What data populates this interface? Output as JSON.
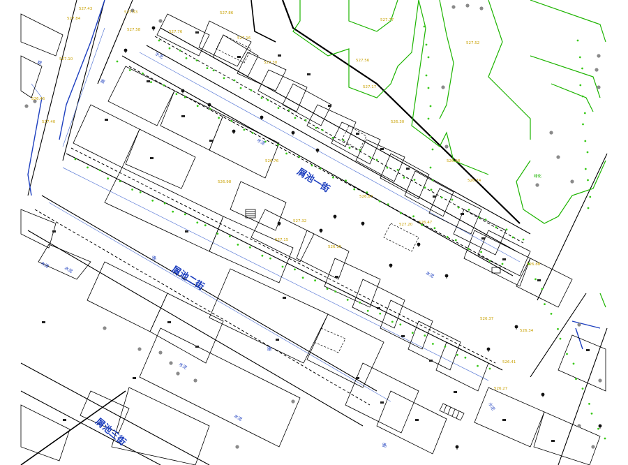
{
  "streets": {
    "main_street": "屑池一街",
    "second_street": "屑池二街",
    "third_street": "屑池三街"
  },
  "labels": {
    "water": "水泥",
    "road": "路",
    "green": "绿化"
  },
  "elevations": [
    "527.43",
    "527.53",
    "527.86",
    "527.84",
    "527.58",
    "527.76",
    "527.77",
    "527.16",
    "527.30",
    "527.10",
    "527.56",
    "527.52",
    "526.46",
    "527.40",
    "527.17",
    "526.30",
    "526.08",
    "526.74",
    "526.76",
    "526.98",
    "526.87",
    "527.20",
    "526.47",
    "527.32",
    "527.15",
    "526.15",
    "526.88",
    "526.34",
    "526.37",
    "526.41",
    "526.27"
  ],
  "colors": {
    "background": "#ffffff",
    "buildings": "#000000",
    "streets_text": "#1d3fbf",
    "greenbelt": "#1db400",
    "elevation_text": "#c8a000",
    "trees": "#808080"
  }
}
